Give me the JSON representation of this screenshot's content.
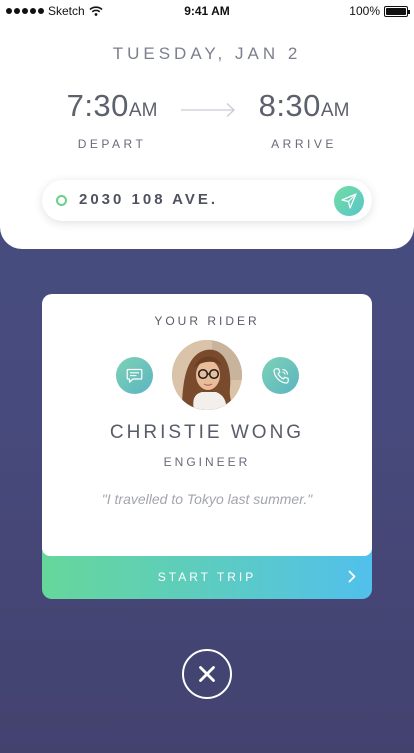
{
  "status_bar": {
    "carrier": "Sketch",
    "time": "9:41 AM",
    "battery": "100%",
    "battery_level": 1.0
  },
  "trip": {
    "date": "TUESDAY, JAN 2",
    "depart": {
      "time": "7:30",
      "ampm": "AM",
      "label": "DEPART"
    },
    "arrive": {
      "time": "8:30",
      "ampm": "AM",
      "label": "ARRIVE"
    },
    "address": "2030 108 AVE."
  },
  "rider_card": {
    "heading": "YOUR RIDER",
    "name": "CHRISTIE WONG",
    "role": "ENGINEER",
    "quote": "\"I travelled to Tokyo last summer.\""
  },
  "actions": {
    "start_trip": "START TRIP"
  },
  "icons": {
    "message": "message-icon",
    "call": "phone-icon",
    "locate": "navigation-arrow-icon",
    "next": "chevron-right-icon",
    "close": "close-icon"
  },
  "colors": {
    "accent_green": "#66d79a",
    "accent_blue": "#51c0ec",
    "background": "#474a7c"
  }
}
